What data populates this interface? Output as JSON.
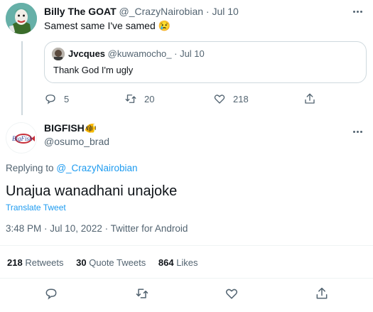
{
  "parent_tweet": {
    "display_name": "Billy The GOAT",
    "handle": "@_CrazyNairobian",
    "separator": "·",
    "date": "Jul 10",
    "text": "Samest same I've samed",
    "emoji": "😢",
    "quoted": {
      "display_name": "Jvcques",
      "handle": "@kuwamocho_",
      "separator": "·",
      "date": "Jul 10",
      "text": "Thank God I'm ugly"
    },
    "replies": "5",
    "retweets": "20",
    "likes": "218"
  },
  "main_tweet": {
    "display_name": "BIGFISH",
    "name_emoji": "🐠",
    "handle": "@osumo_brad",
    "avatar_text": "BigFish",
    "replying_to_label": "Replying to",
    "replying_to_handle": "@_CrazyNairobian",
    "text": "Unajua wanadhani unajoke",
    "translate": "Translate Tweet",
    "timestamp": "3:48 PM · Jul 10, 2022 · Twitter for Android",
    "stats": {
      "retweets_count": "218",
      "retweets_label": "Retweets",
      "quotes_count": "30",
      "quotes_label": "Quote Tweets",
      "likes_count": "864",
      "likes_label": "Likes"
    }
  },
  "colors": {
    "accent": "#1d9bf0",
    "muted": "#536471",
    "border": "#cfd9de"
  },
  "icons": [
    "reply-icon",
    "retweet-icon",
    "like-icon",
    "share-icon",
    "more-icon"
  ]
}
